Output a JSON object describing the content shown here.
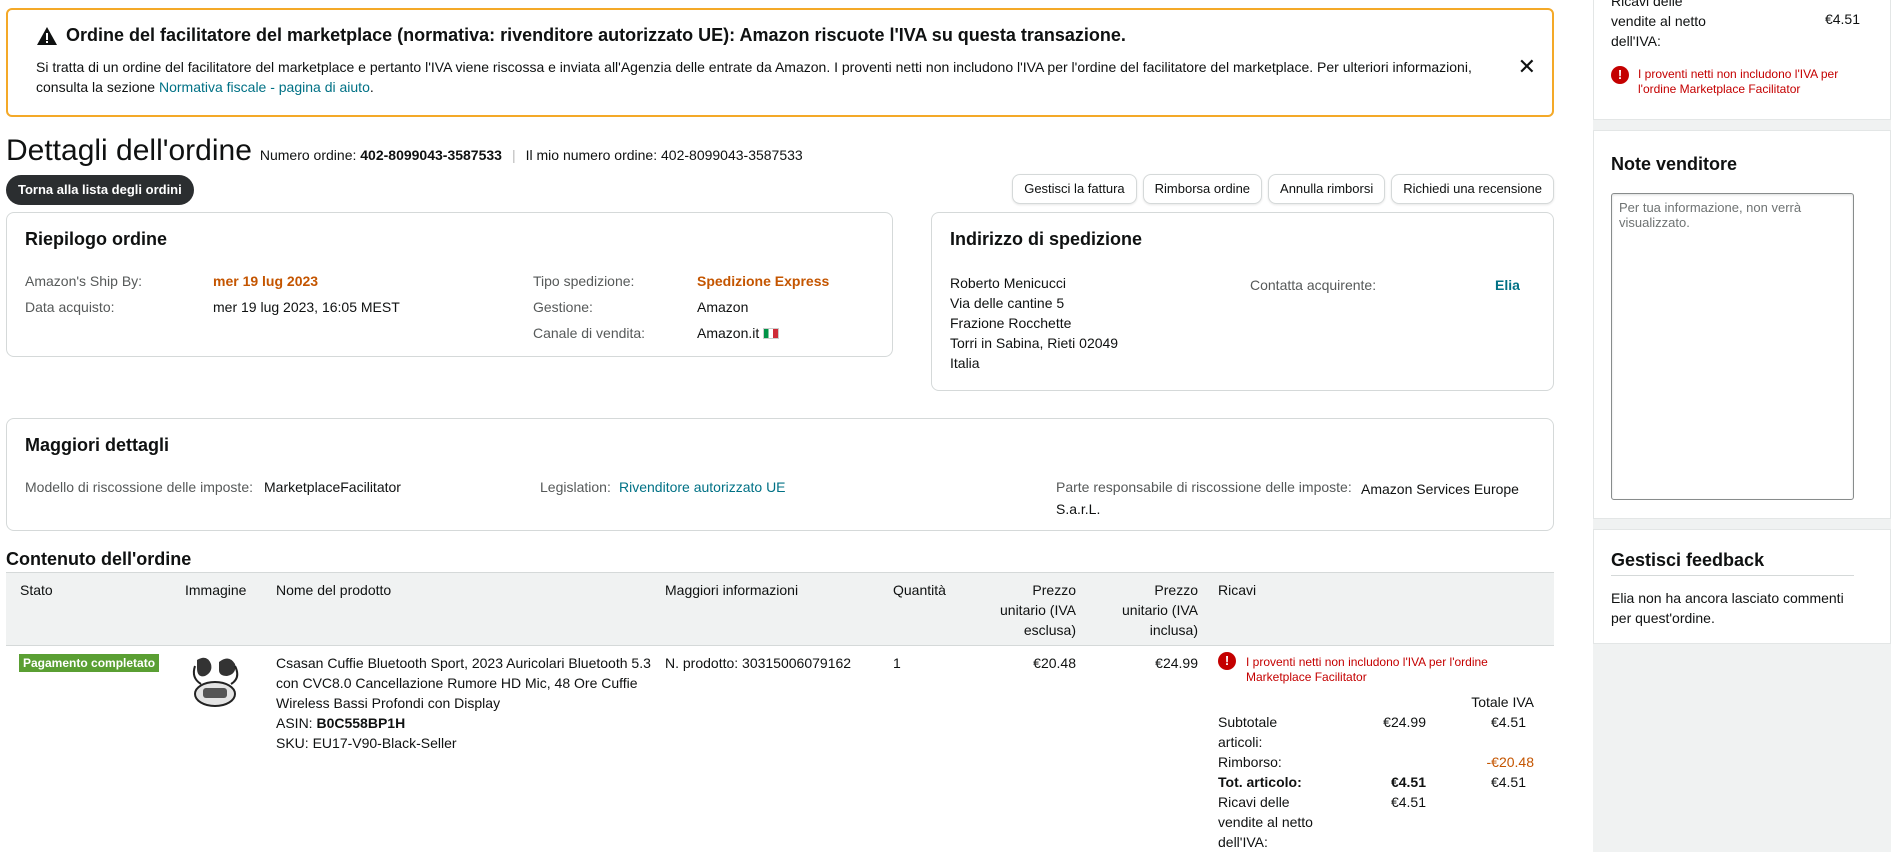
{
  "banner": {
    "title": "Ordine del facilitatore del marketplace (normativa: rivenditore autorizzato UE): Amazon riscuote l'IVA su questa transazione.",
    "text": "Si tratta di un ordine del facilitatore del marketplace e pertanto l'IVA viene riscossa e inviata all'Agenzia delle entrate da Amazon. I proventi netti non includono l'IVA per l'ordine del facilitatore del marketplace. Per ulteriori informazioni, consulta la sezione ",
    "link": "Normativa fiscale - pagina di aiuto",
    "text_end": ".",
    "close": "✕"
  },
  "header": {
    "title": "Dettagli dell'ordine",
    "order_label": "Numero ordine:",
    "order_number": "402-8099043-3587533",
    "my_order_label": "Il mio numero ordine:",
    "my_order_number": "402-8099043-3587533",
    "back_button": "Torna alla lista degli ordini",
    "actions": [
      "Gestisci la fattura",
      "Rimborsa ordine",
      "Annulla rimborsi",
      "Richiedi una recensione"
    ]
  },
  "summary": {
    "title": "Riepilogo ordine",
    "ship_by_label": "Amazon's Ship By:",
    "ship_by": "mer 19 lug 2023",
    "purchase_label": "Data acquisto:",
    "purchase_date": "mer 19 lug 2023, 16:05 MEST",
    "shipping_type_label": "Tipo spedizione:",
    "shipping_type": "Spedizione Express",
    "fulfillment_label": "Gestione:",
    "fulfillment": "Amazon",
    "channel_label": "Canale di vendita:",
    "channel": "Amazon.it"
  },
  "address": {
    "title": "Indirizzo di spedizione",
    "lines": [
      "Roberto Menicucci",
      "Via delle cantine 5",
      "Frazione Rocchette",
      "Torri in Sabina, Rieti 02049",
      "Italia"
    ],
    "contact_label": "Contatta acquirente:",
    "contact_name": "Elia"
  },
  "details": {
    "title": "Maggiori dettagli",
    "tax_model_label": "Modello di riscossione delle imposte:",
    "tax_model": "MarketplaceFacilitator",
    "legislation_label": "Legislation:",
    "legislation": "Rivenditore autorizzato UE",
    "responsible_label": "Parte responsabile di riscossione delle imposte:",
    "responsible": "Amazon Services Europe S.a.r.L."
  },
  "contents": {
    "title": "Contenuto dell'ordine",
    "columns": [
      "Stato",
      "Immagine",
      "Nome del prodotto",
      "Maggiori informazioni",
      "Quantità",
      "Prezzo unitario (IVA esclusa)",
      "Prezzo unitario (IVA inclusa)",
      "Ricavi"
    ],
    "row": {
      "status": "Pagamento completato",
      "product_name": "Csasan Cuffie Bluetooth Sport, 2023 Auricolari Bluetooth 5.3 con CVC8.0 Cancellazione Rumore HD Mic, 48 Ore Cuffie Wireless Bassi Profondi con Display",
      "asin_label": "ASIN:",
      "asin": "B0C558BP1H",
      "sku_label": "SKU:",
      "sku": "EU17-V90-Black-Seller",
      "info": "N. prodotto: 30315006079162",
      "quantity": "1",
      "price_ex": "€20.48",
      "price_inc": "€24.99",
      "revenue_warning": "I proventi netti non includono l'IVA per l'ordine Marketplace Facilitator",
      "vat_total_label": "Totale IVA",
      "subtotal_label": "Subtotale articoli:",
      "subtotal": "€24.99",
      "subtotal_vat": "€4.51",
      "refund_label": "Rimborso:",
      "refund_vat": "-€20.48",
      "total_label": "Tot. articolo:",
      "total": "€4.51",
      "total_vat": "€4.51",
      "net_label": "Ricavi delle vendite al netto dell'IVA:",
      "net": "€4.51"
    }
  },
  "sidebar": {
    "top_label": "Ricavi delle vendite al netto dell'IVA:",
    "top_value": "€4.51",
    "top_warning": "I proventi netti non includono l'IVA per l'ordine Marketplace Facilitator",
    "notes_title": "Note venditore",
    "notes_placeholder": "Per tua informazione, non verrà visualizzato.",
    "feedback_title": "Gestisci feedback",
    "feedback_text": "Elia non ha ancora lasciato commenti per quest'ordine."
  },
  "colors": {
    "banner_border": "#f4a928",
    "link": "#007185",
    "orange": "#c45500",
    "badge": "#5a9f33",
    "error": "#c40000"
  }
}
